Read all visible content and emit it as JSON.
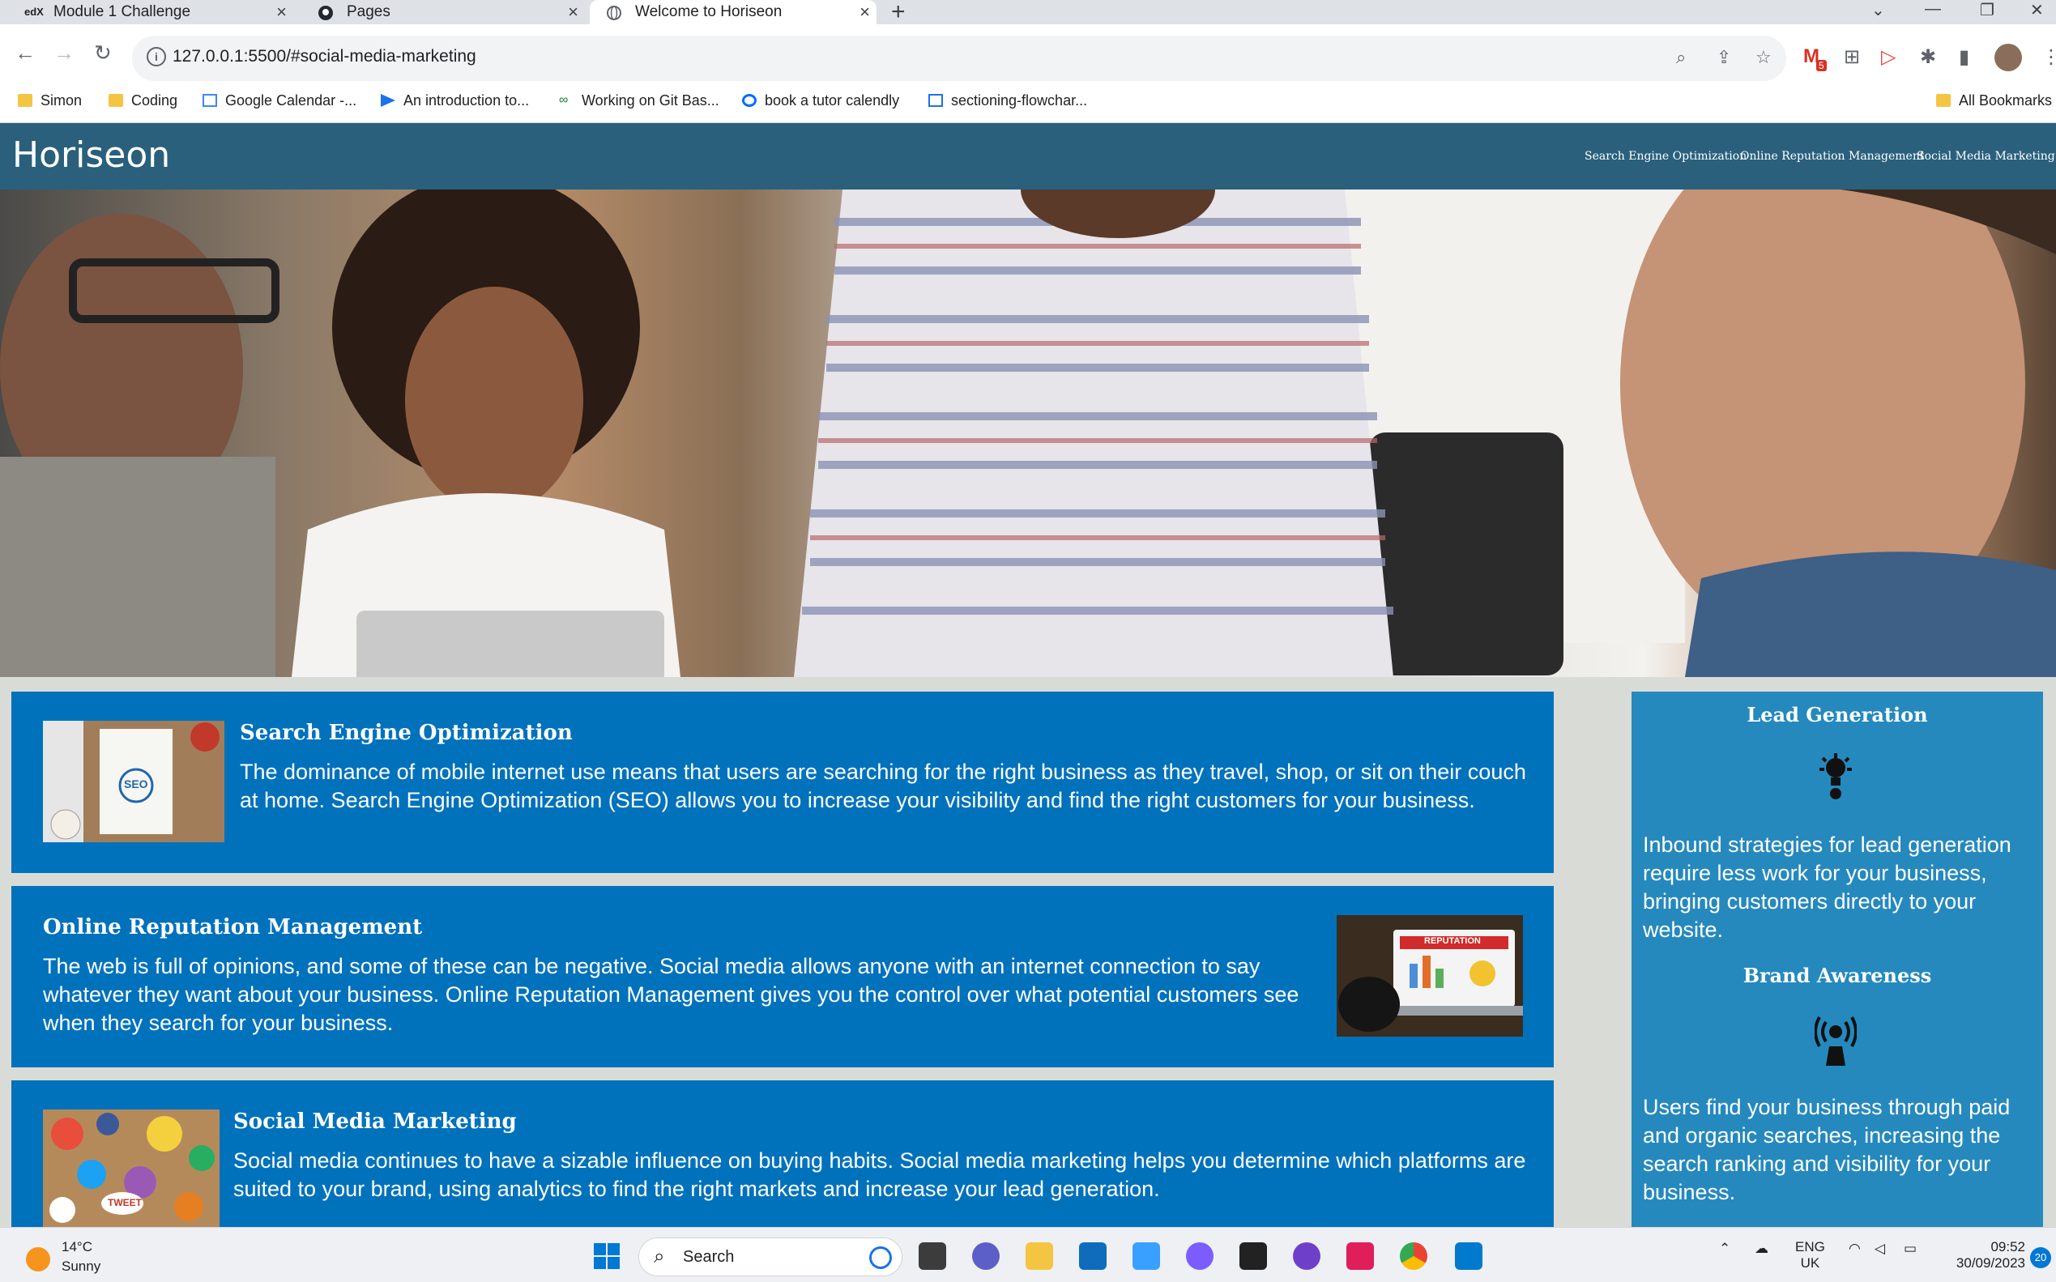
{
  "browser": {
    "tabs": [
      {
        "title": "Module 1 Challenge",
        "icon": "edx-icon",
        "active": false
      },
      {
        "title": "Pages",
        "icon": "github-icon",
        "active": false
      },
      {
        "title": "Welcome to Horiseon",
        "icon": "globe-icon",
        "active": true
      }
    ],
    "url": "127.0.0.1:5500/#social-media-marketing",
    "bookmarks": [
      {
        "label": "Simon",
        "icon": "folder-icon"
      },
      {
        "label": "Coding",
        "icon": "folder-icon"
      },
      {
        "label": "Google Calendar -...",
        "icon": "calendar-icon"
      },
      {
        "label": "An introduction to...",
        "icon": "play-icon"
      },
      {
        "label": "Working on Git Bas...",
        "icon": "link-icon"
      },
      {
        "label": "book a tutor calendly",
        "icon": "calendly-icon"
      },
      {
        "label": "sectioning-flowchar...",
        "icon": "doc-icon"
      }
    ],
    "all_bookmarks": "All Bookmarks",
    "gmail_badge": "5"
  },
  "site": {
    "logo": "Horiseon",
    "nav": [
      "Search Engine Optimization",
      "Online Reputation Management",
      "Social Media Marketing"
    ],
    "cards": [
      {
        "title": "Search Engine Optimization",
        "text": "The dominance of mobile internet use means that users are searching for the right business as they travel, shop, or sit on their couch at home. Search Engine Optimization (SEO) allows you to increase your visibility and find the right customers for your business.",
        "thumb_text": "SEO"
      },
      {
        "title": "Online Reputation Management",
        "text": "The web is full of opinions, and some of these can be negative. Social media allows anyone with an internet connection to say whatever they want about your business. Online Reputation Management gives you the control over what potential customers see when they search for your business.",
        "thumb_text": "REPUTATION"
      },
      {
        "title": "Social Media Marketing",
        "text": "Social media continues to have a sizable influence on buying habits. Social media marketing helps you determine which platforms are suited to your brand, using analytics to find the right markets and increase your lead generation.",
        "thumb_text": "TWEET"
      }
    ],
    "benefits": [
      {
        "title": "Lead Generation",
        "text": "Inbound strategies for lead generation require less work for your business, bringing customers directly to your website.",
        "icon": "lead-generation-icon"
      },
      {
        "title": "Brand Awareness",
        "text": "Users find your business through paid and organic searches, increasing the search ranking and visibility for your business.",
        "icon": "brand-awareness-icon"
      }
    ],
    "colors": {
      "header": "#2a607c",
      "card": "#0072bb",
      "aside": "#2589bd"
    }
  },
  "taskbar": {
    "weather_temp": "14°C",
    "weather_desc": "Sunny",
    "search_placeholder": "Search",
    "lang": "ENG",
    "region": "UK",
    "time": "09:52",
    "date": "30/09/2023",
    "notifications": "20"
  }
}
